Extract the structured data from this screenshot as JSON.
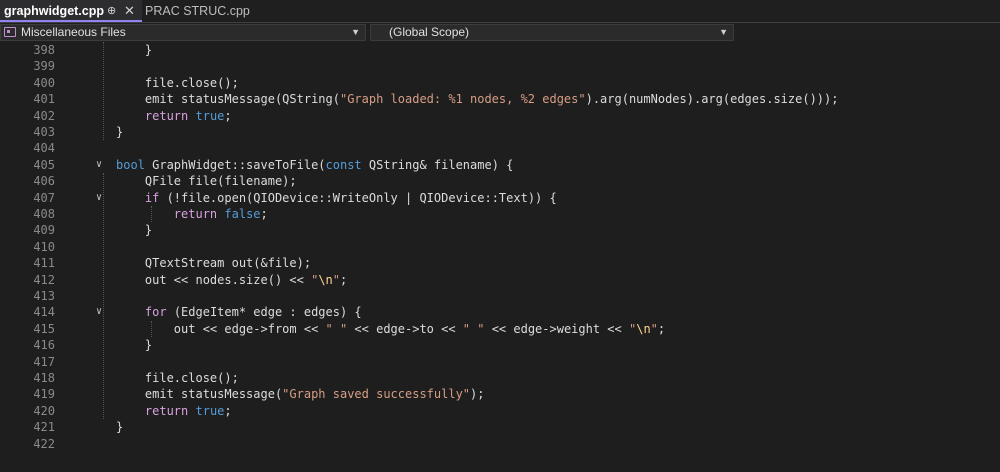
{
  "tabs": {
    "active": {
      "title": "graphwidget.cpp",
      "pin": "⊕",
      "close": "✕"
    },
    "inactive": {
      "title": "PRAC STRUC.cpp"
    }
  },
  "nav": {
    "project_combo": "Miscellaneous Files",
    "scope_combo": "(Global Scope)"
  },
  "colors": {
    "background": "#1e1e1e",
    "keyword": "#569cd6",
    "control_keyword": "#d8a0df",
    "type": "#4ec9b0",
    "function": "#dcdcaa",
    "string": "#d69d85",
    "line_number": "#8a8a8a",
    "tab_accent": "#9184ee"
  },
  "lines": [
    {
      "n": "398",
      "t": [
        [
          "id",
          "    }"
        ]
      ]
    },
    {
      "n": "399",
      "t": []
    },
    {
      "n": "400",
      "t": [
        [
          "id",
          "    file.close();"
        ]
      ]
    },
    {
      "n": "401",
      "t": [
        [
          "id",
          "    emit statusMessage(QString("
        ],
        [
          "str",
          "\"Graph loaded: %1 nodes, %2 edges\""
        ],
        [
          "id",
          ").arg(numNodes).arg(edges.size()));"
        ]
      ]
    },
    {
      "n": "402",
      "t": [
        [
          "id",
          "    "
        ],
        [
          "kwc",
          "return"
        ],
        [
          "id",
          " "
        ],
        [
          "kw",
          "true"
        ],
        [
          "id",
          ";"
        ]
      ]
    },
    {
      "n": "403",
      "t": [
        [
          "id",
          "}"
        ]
      ]
    },
    {
      "n": "404",
      "t": []
    },
    {
      "n": "405",
      "fold": "∨",
      "t": [
        [
          "kw",
          "bool"
        ],
        [
          "id",
          " GraphWidget::saveToFile("
        ],
        [
          "kw",
          "const"
        ],
        [
          "id",
          " QString& filename) {"
        ]
      ]
    },
    {
      "n": "406",
      "t": [
        [
          "id",
          "    QFile file(filename);"
        ]
      ]
    },
    {
      "n": "407",
      "fold": "∨",
      "t": [
        [
          "id",
          "    "
        ],
        [
          "kwc",
          "if"
        ],
        [
          "id",
          " (!file.open(QIODevice::WriteOnly | QIODevice::Text)) {"
        ]
      ]
    },
    {
      "n": "408",
      "t": [
        [
          "id",
          "        "
        ],
        [
          "kwc",
          "return"
        ],
        [
          "id",
          " "
        ],
        [
          "kw",
          "false"
        ],
        [
          "id",
          ";"
        ]
      ]
    },
    {
      "n": "409",
      "t": [
        [
          "id",
          "    }"
        ]
      ]
    },
    {
      "n": "410",
      "t": []
    },
    {
      "n": "411",
      "t": [
        [
          "id",
          "    QTextStream out(&file);"
        ]
      ]
    },
    {
      "n": "412",
      "t": [
        [
          "id",
          "    out << nodes.size() << "
        ],
        [
          "str",
          "\""
        ],
        [
          "esc",
          "\\n"
        ],
        [
          "str",
          "\""
        ],
        [
          "id",
          ";"
        ]
      ]
    },
    {
      "n": "413",
      "t": []
    },
    {
      "n": "414",
      "fold": "∨",
      "t": [
        [
          "id",
          "    "
        ],
        [
          "kwc",
          "for"
        ],
        [
          "id",
          " (EdgeItem* edge : edges) {"
        ]
      ]
    },
    {
      "n": "415",
      "t": [
        [
          "id",
          "        out << edge->from << "
        ],
        [
          "str",
          "\" \""
        ],
        [
          "id",
          " << edge->to << "
        ],
        [
          "str",
          "\" \""
        ],
        [
          "id",
          " << edge->weight << "
        ],
        [
          "str",
          "\""
        ],
        [
          "esc",
          "\\n"
        ],
        [
          "str",
          "\""
        ],
        [
          "id",
          ";"
        ]
      ]
    },
    {
      "n": "416",
      "t": [
        [
          "id",
          "    }"
        ]
      ]
    },
    {
      "n": "417",
      "t": []
    },
    {
      "n": "418",
      "t": [
        [
          "id",
          "    file.close();"
        ]
      ]
    },
    {
      "n": "419",
      "t": [
        [
          "id",
          "    emit statusMessage("
        ],
        [
          "str",
          "\"Graph saved successfully\""
        ],
        [
          "id",
          ");"
        ]
      ]
    },
    {
      "n": "420",
      "t": [
        [
          "id",
          "    "
        ],
        [
          "kwc",
          "return"
        ],
        [
          "id",
          " "
        ],
        [
          "kw",
          "true"
        ],
        [
          "id",
          ";"
        ]
      ]
    },
    {
      "n": "421",
      "t": [
        [
          "id",
          "}"
        ]
      ]
    },
    {
      "n": "422",
      "t": []
    }
  ]
}
